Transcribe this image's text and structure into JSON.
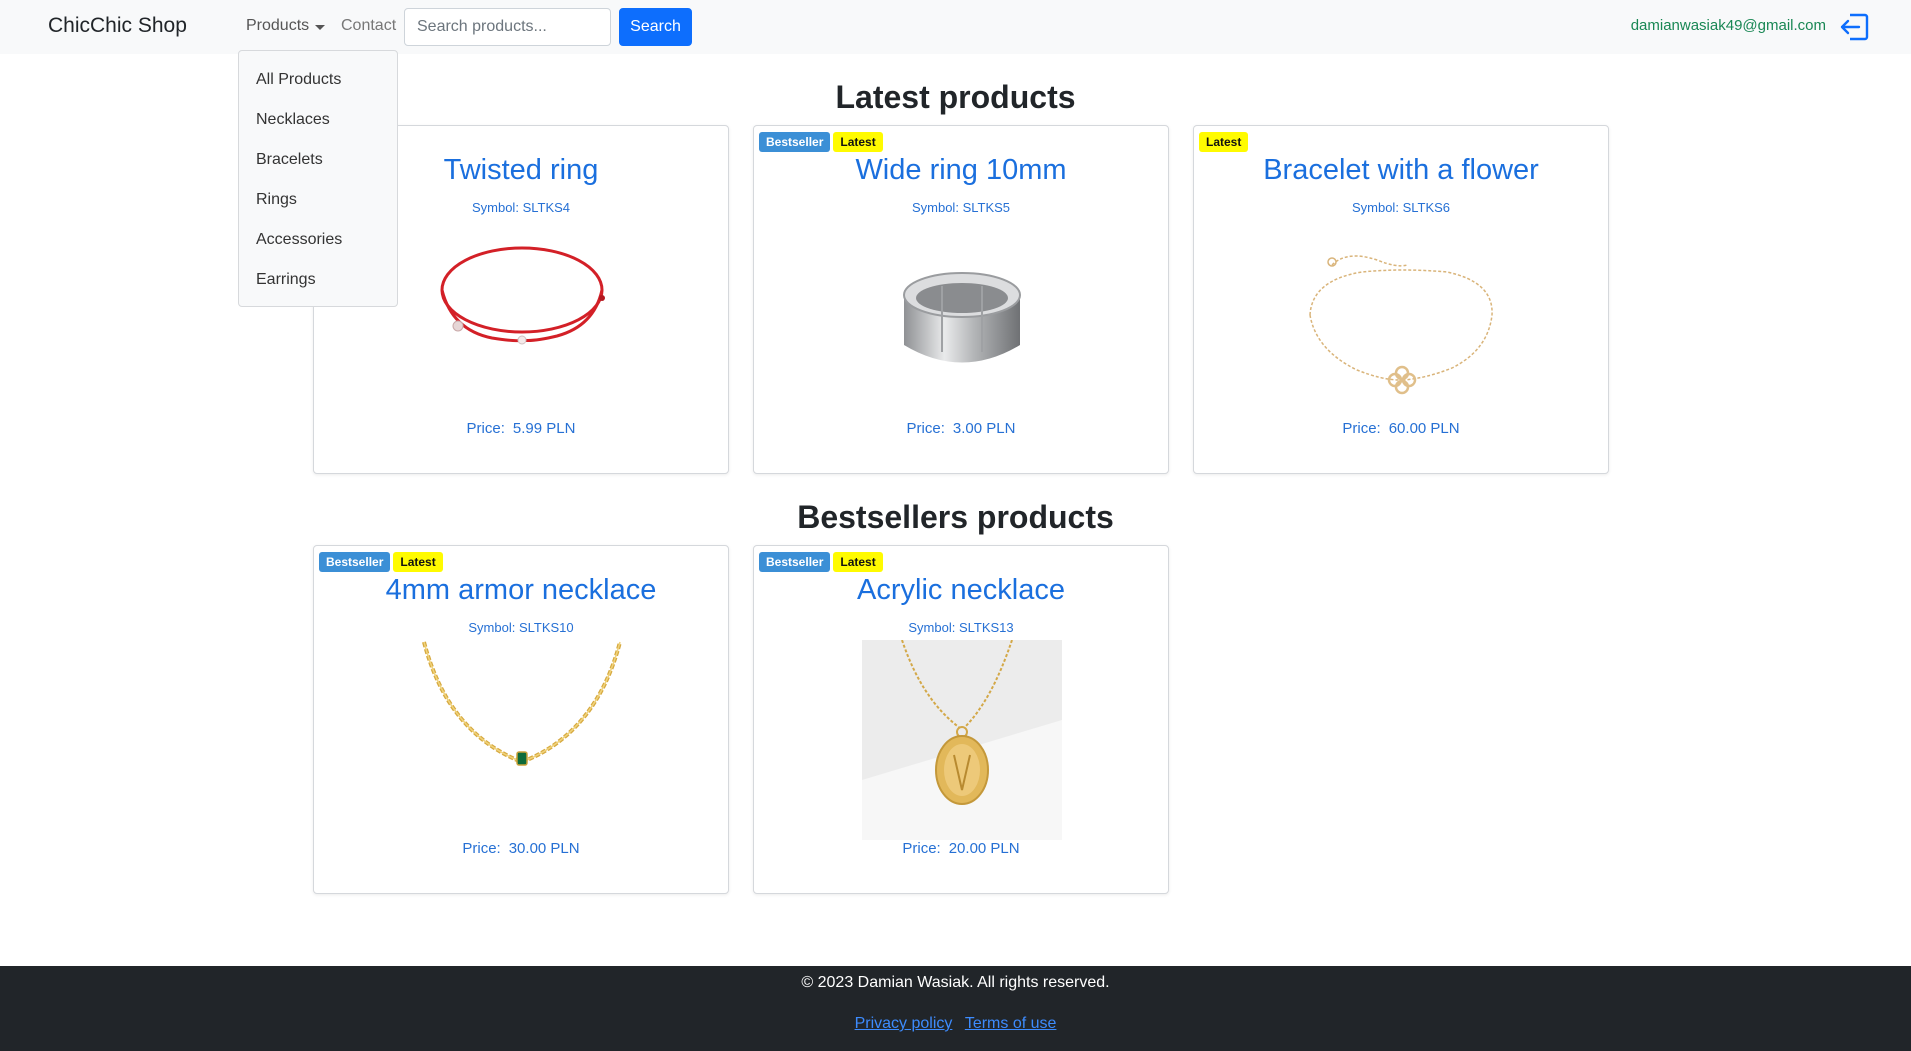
{
  "navbar": {
    "brand": "ChicChic Shop",
    "products_label": "Products",
    "contact_label": "Contact",
    "search_placeholder": "Search products...",
    "search_button": "Search",
    "user_email": "damianwasiak49@gmail.com"
  },
  "dropdown": {
    "items": [
      "All Products",
      "Necklaces",
      "Bracelets",
      "Rings",
      "Accessories",
      "Earrings"
    ]
  },
  "latest": {
    "title": "Latest products",
    "products": [
      {
        "name": "Twisted ring",
        "symbol_label": "Symbol:",
        "symbol": "SLTKS4",
        "price_label": "Price:",
        "price": "5.99 PLN",
        "badges": []
      },
      {
        "name": "Wide ring 10mm",
        "symbol_label": "Symbol:",
        "symbol": "SLTKS5",
        "price_label": "Price:",
        "price": "3.00 PLN",
        "badges": [
          "Bestseller",
          "Latest"
        ]
      },
      {
        "name": "Bracelet with a flower",
        "symbol_label": "Symbol:",
        "symbol": "SLTKS6",
        "price_label": "Price:",
        "price": "60.00 PLN",
        "badges": [
          "Latest"
        ]
      }
    ]
  },
  "bestsellers": {
    "title": "Bestsellers products",
    "products": [
      {
        "name": "4mm armor necklace",
        "symbol_label": "Symbol:",
        "symbol": "SLTKS10",
        "price_label": "Price:",
        "price": "30.00 PLN",
        "badges": [
          "Bestseller",
          "Latest"
        ]
      },
      {
        "name": "Acrylic necklace",
        "symbol_label": "Symbol:",
        "symbol": "SLTKS13",
        "price_label": "Price:",
        "price": "20.00 PLN",
        "badges": [
          "Bestseller",
          "Latest"
        ]
      }
    ]
  },
  "footer": {
    "copyright": "© 2023 Damian Wasiak. All rights reserved.",
    "privacy": "Privacy policy",
    "terms": "Terms of use"
  },
  "colors": {
    "primary": "#0d6efd",
    "bestseller_badge": "#3b8fd6",
    "latest_badge": "#fffb00",
    "email": "#198754",
    "footer_bg": "#212529"
  },
  "icons": {
    "logout": "logout-icon",
    "caret": "chevron-down-icon"
  }
}
